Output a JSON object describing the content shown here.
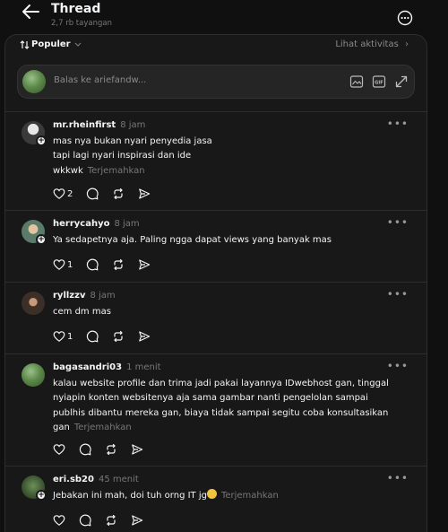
{
  "header": {
    "title": "Thread",
    "views": "2,7 rb tayangan"
  },
  "sortbar": {
    "sort_label": "Populer",
    "activity_label": "Lihat aktivitas",
    "activity_chevron": "›"
  },
  "reply": {
    "placeholder": "Balas ke ariefandw..."
  },
  "translate_label": "Terjemahkan",
  "comments": [
    {
      "username": "mr.rheinfirst",
      "time": "8 jam",
      "lines": [
        "mas nya bukan nyari penyedia jasa",
        "tapi lagi nyari inspirasi dan ide",
        "wkkwk"
      ],
      "likes": "2"
    },
    {
      "username": "herrycahyo",
      "time": "8 jam",
      "lines": [
        "Ya sedapetnya aja. Paling ngga dapat views yang banyak mas"
      ],
      "likes": "1"
    },
    {
      "username": "ryllzzv",
      "time": "8 jam",
      "lines": [
        "cem dm mas"
      ],
      "likes": "1"
    },
    {
      "username": "bagasandri03",
      "time": "1 menit",
      "lines": [
        "kalau website profile dan trima jadi pakai layannya IDwebhost gan, tinggal",
        "nyiapin konten websitenya aja sama gambar nanti pengelolan sampai",
        "publhis dibantu mereka gan, biaya tidak sampai segitu coba konsultasikan",
        "gan"
      ],
      "likes": ""
    },
    {
      "username": "eri.sb20",
      "time": "45 menit",
      "lines": [
        "Jebakan ini mah, doi tuh orng IT jg"
      ],
      "likes": ""
    }
  ],
  "colors": {
    "background": "#101010",
    "panel": "#181818",
    "border": "#2d2d2d",
    "text": "#f3f5f7",
    "muted": "#777777"
  }
}
